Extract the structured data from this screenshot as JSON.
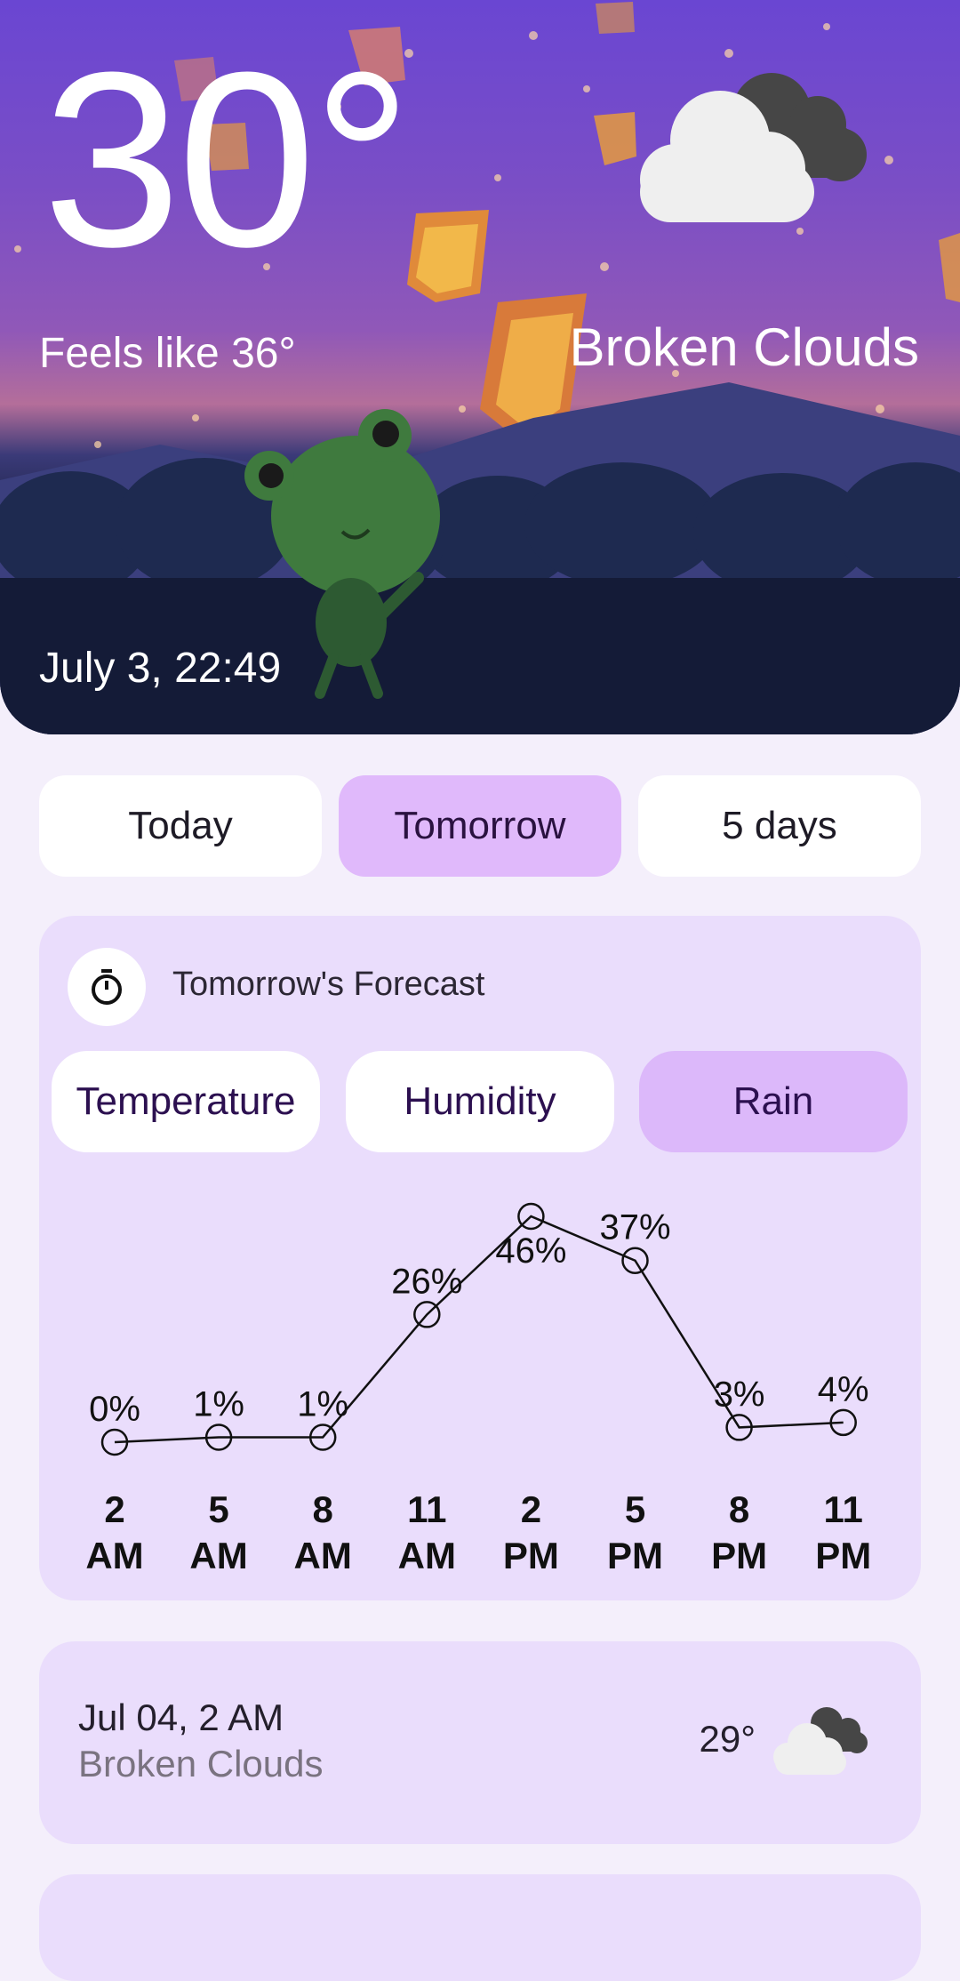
{
  "hero": {
    "temperature": "30°",
    "feels_like": "Feels like 36°",
    "condition": "Broken Clouds",
    "datetime": "July 3, 22:49",
    "weather_icon": "broken-clouds-icon"
  },
  "day_tabs": [
    {
      "label": "Today",
      "active": false
    },
    {
      "label": "Tomorrow",
      "active": true
    },
    {
      "label": "5 days",
      "active": false
    }
  ],
  "forecast": {
    "title": "Tomorrow's Forecast",
    "icon": "timer-icon",
    "metrics": [
      {
        "label": "Temperature",
        "active": false
      },
      {
        "label": "Humidity",
        "active": false
      },
      {
        "label": "Rain",
        "active": true
      }
    ]
  },
  "chart_data": {
    "type": "line",
    "x": [
      "2 AM",
      "5 AM",
      "8 AM",
      "11 AM",
      "2 PM",
      "5 PM",
      "8 PM",
      "11 PM"
    ],
    "x_lines": [
      [
        "2",
        "AM"
      ],
      [
        "5",
        "AM"
      ],
      [
        "8",
        "AM"
      ],
      [
        "11",
        "AM"
      ],
      [
        "2",
        "PM"
      ],
      [
        "5",
        "PM"
      ],
      [
        "8",
        "PM"
      ],
      [
        "11",
        "PM"
      ]
    ],
    "values": [
      0,
      1,
      1,
      26,
      46,
      37,
      3,
      4
    ],
    "labels": [
      "0%",
      "1%",
      "1%",
      "26%",
      "46%",
      "37%",
      "3%",
      "4%"
    ],
    "unit": "%",
    "grid": false
  },
  "hourly": [
    {
      "date": "Jul 04, 2 AM",
      "condition": "Broken Clouds",
      "temp": "29°",
      "icon": "broken-clouds-icon"
    }
  ],
  "colors": {
    "card_bg": "#eaddfc",
    "active_tab": "#e0b9fb",
    "page_bg": "#f4effb"
  }
}
